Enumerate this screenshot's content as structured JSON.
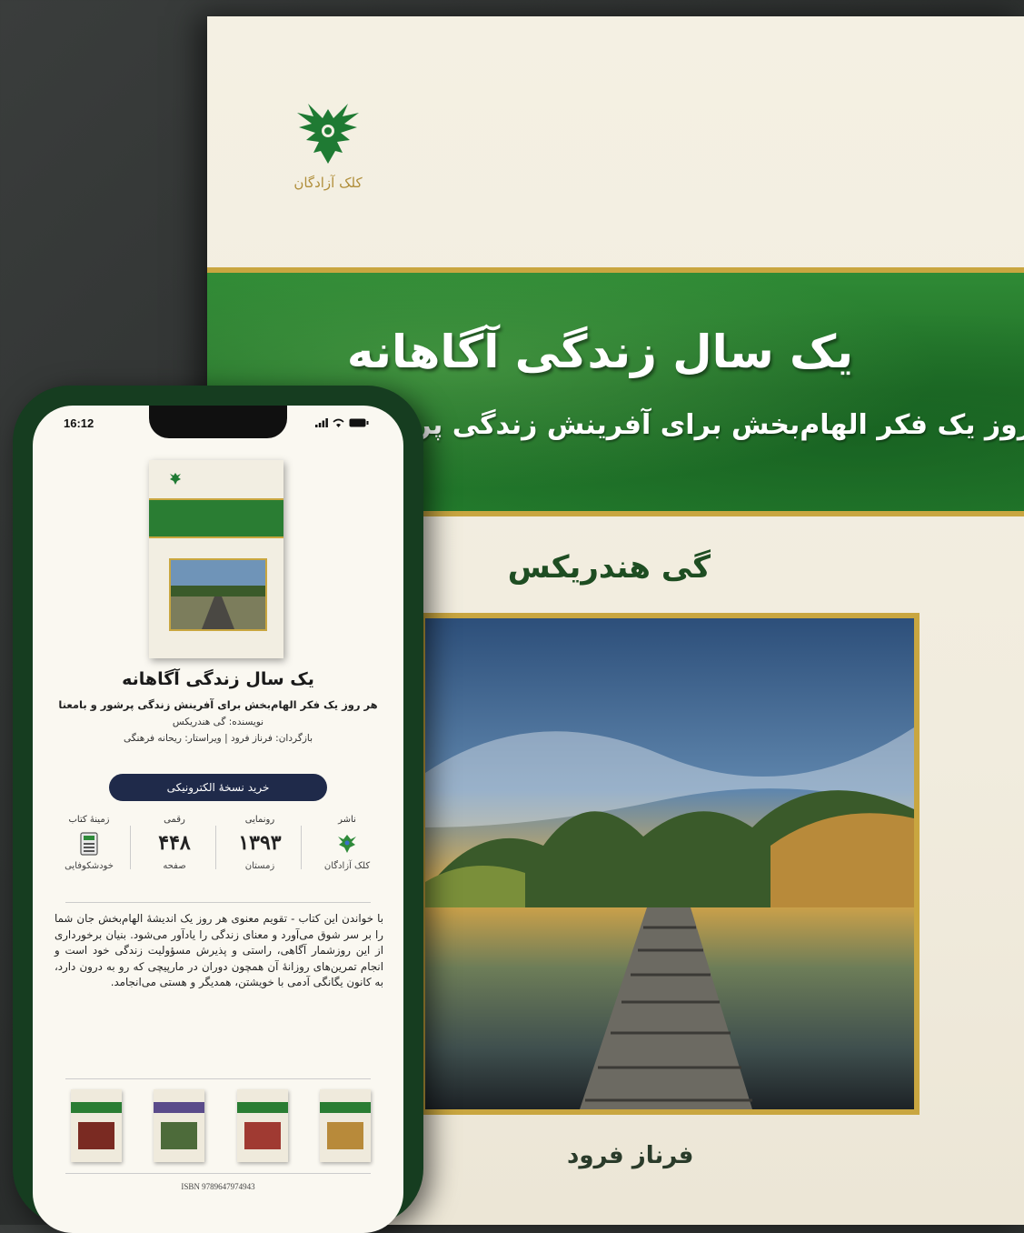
{
  "cover": {
    "publisher": "کلک آزادگان",
    "title": "یک سال زندگی آگاهانه",
    "subtitle": "هر روز یک فکر الهام‌بخش برای آفرینش زندگی پر",
    "author": "گی هندریکس",
    "translator": "فرناز فرود"
  },
  "phone": {
    "status_time": "16:12",
    "book_title": "یک سال زندگی آگاهانه",
    "book_subtitle": "هر روز یک فکر الهام‌بخش برای آفرینش زندگی پرشور و بامعنا",
    "author_line": "نویسنده: گی هندریکس",
    "translator_line": "بازگردان: فرناز فرود | ویراستار: ریحانه فرهنگی",
    "buy_button": "خرید نسخهٔ الکترونیکی",
    "info": [
      {
        "label": "ناشر",
        "value": "",
        "sub": "کلک آزادگان",
        "icon": "publisher-logo-icon"
      },
      {
        "label": "رونمایی",
        "value": "۱۳۹۳",
        "sub": "زمستان"
      },
      {
        "label": "رقمی",
        "value": "۴۴۸",
        "sub": "صفحه"
      },
      {
        "label": "زمینهٔ کتاب",
        "value": "",
        "sub": "خودشکوفایی",
        "icon": "calculator-icon"
      }
    ],
    "description": "با خواندن این کتاب - تقویم معنوی هر روز یک اندیشهٔ الهام‌بخش جان شما را بر سر شوق می‌آورد و معنای زندگی را یادآور می‌شود. بنیان برخورداری از این روزشمار آگاهی، راستی و پذیرش مسؤولیت زندگی خود است و انجام تمرین‌های روزانهٔ آن همچون دوران در مارپیچی که رو به درون دارد، به کانون یگانگی آدمی با خویشتن، همدیگر و هستی می‌انجامد.",
    "isbn": "ISBN 9789647974943",
    "related_band_colors": [
      "#2a7d33",
      "#5a4b8a",
      "#2a7d33",
      "#2a7d33"
    ]
  }
}
